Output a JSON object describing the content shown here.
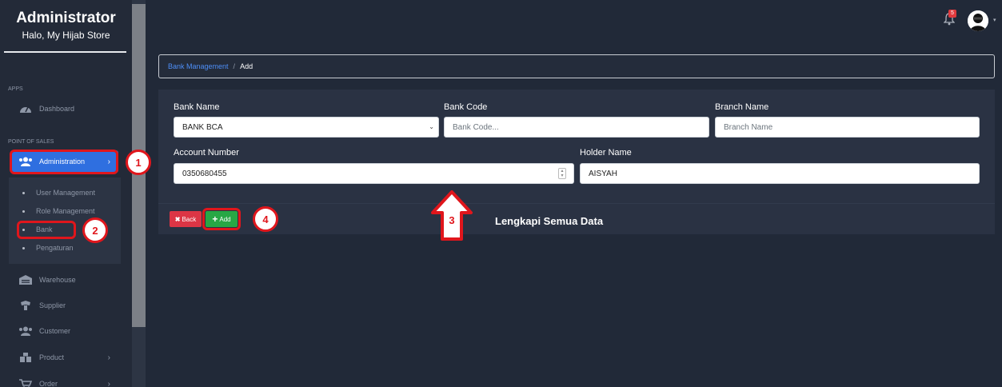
{
  "sidebar": {
    "brand_title": "Administrator",
    "brand_subtitle": "Halo, My Hijab Store",
    "section_apps": "APPS",
    "section_pos": "POINT OF SALES",
    "items": [
      {
        "label": "Dashboard",
        "icon": "dashboard-icon"
      },
      {
        "label": "Administration",
        "icon": "users-icon",
        "active": true
      },
      {
        "label": "Warehouse",
        "icon": "warehouse-icon"
      },
      {
        "label": "Supplier",
        "icon": "supplier-icon"
      },
      {
        "label": "Customer",
        "icon": "users-icon"
      },
      {
        "label": "Product",
        "icon": "box-icon"
      },
      {
        "label": "Order",
        "icon": "cart-icon"
      }
    ],
    "submenu": [
      {
        "label": "User Management"
      },
      {
        "label": "Role Management"
      },
      {
        "label": "Bank"
      },
      {
        "label": "Pengaturan"
      }
    ]
  },
  "topbar": {
    "notification_count": "5"
  },
  "breadcrumb": {
    "parent": "Bank Management",
    "separator": "/",
    "current": "Add"
  },
  "form": {
    "bank_name_label": "Bank Name",
    "bank_name_value": "BANK BCA",
    "bank_code_label": "Bank Code",
    "bank_code_placeholder": "Bank Code...",
    "branch_name_label": "Branch Name",
    "branch_name_placeholder": "Branch Name",
    "account_number_label": "Account Number",
    "account_number_value": "0350680455",
    "holder_name_label": "Holder Name",
    "holder_name_value": "AISYAH"
  },
  "actions": {
    "back_label": "Back",
    "add_label": "Add"
  },
  "annotations": {
    "step_1": "1",
    "step_2": "2",
    "step_3": "3",
    "step_4": "4",
    "note": "Lengkapi Semua Data"
  },
  "colors": {
    "background": "#212938",
    "accent": "#2f6fe0",
    "danger": "#dc3545",
    "success": "#28a745",
    "annotation": "#e0161c"
  }
}
